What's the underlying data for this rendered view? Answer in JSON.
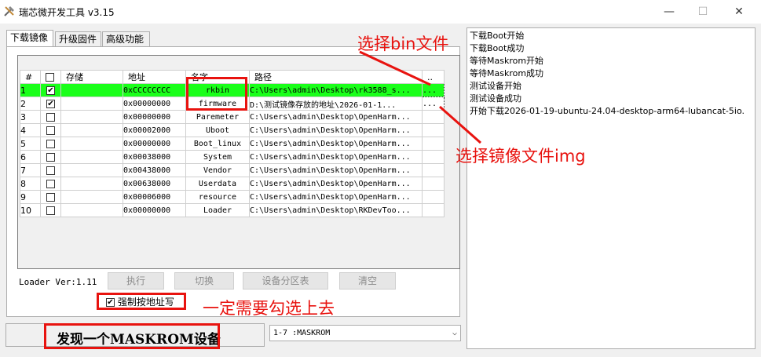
{
  "window": {
    "title": "瑞芯微开发工具 v3.15",
    "controls": [
      "—",
      "☐",
      "✕"
    ]
  },
  "tabs": [
    "下载镜像",
    "升级固件",
    "高级功能"
  ],
  "grid": {
    "headers": [
      "#",
      "☐",
      "存储",
      "地址",
      "名字",
      "路径",
      ".."
    ],
    "rows": [
      {
        "num": "1",
        "checked": true,
        "storage": "",
        "addr": "0xCCCCCCCC",
        "name": "rkbin",
        "path": "C:\\Users\\admin\\Desktop\\rk3588_s...",
        "extra": "..."
      },
      {
        "num": "2",
        "checked": true,
        "storage": "",
        "addr": "0x00000000",
        "name": "firmware",
        "path": "D:\\测试镜像存放的地址\\2026-01-1...",
        "extra": "..."
      },
      {
        "num": "3",
        "checked": false,
        "storage": "",
        "addr": "0x00000000",
        "name": "Paremeter",
        "path": "C:\\Users\\admin\\Desktop\\OpenHarm...",
        "extra": ""
      },
      {
        "num": "4",
        "checked": false,
        "storage": "",
        "addr": "0x00002000",
        "name": "Uboot",
        "path": "C:\\Users\\admin\\Desktop\\OpenHarm...",
        "extra": ""
      },
      {
        "num": "5",
        "checked": false,
        "storage": "",
        "addr": "0x00000000",
        "name": "Boot_linux",
        "path": "C:\\Users\\admin\\Desktop\\OpenHarm...",
        "extra": ""
      },
      {
        "num": "6",
        "checked": false,
        "storage": "",
        "addr": "0x00038000",
        "name": "System",
        "path": "C:\\Users\\admin\\Desktop\\OpenHarm...",
        "extra": ""
      },
      {
        "num": "7",
        "checked": false,
        "storage": "",
        "addr": "0x00438000",
        "name": "Vendor",
        "path": "C:\\Users\\admin\\Desktop\\OpenHarm...",
        "extra": ""
      },
      {
        "num": "8",
        "checked": false,
        "storage": "",
        "addr": "0x00638000",
        "name": "Userdata",
        "path": "C:\\Users\\admin\\Desktop\\OpenHarm...",
        "extra": ""
      },
      {
        "num": "9",
        "checked": false,
        "storage": "",
        "addr": "0x00006000",
        "name": "resource",
        "path": "C:\\Users\\admin\\Desktop\\OpenHarm...",
        "extra": ""
      },
      {
        "num": "10",
        "checked": false,
        "storage": "",
        "addr": "0x00000000",
        "name": "Loader",
        "path": "C:\\Users\\admin\\Desktop\\RKDevToo...",
        "extra": ""
      }
    ]
  },
  "loader_ver": "Loader Ver:1.11",
  "buttons": {
    "execute": "执行",
    "switch": "切换",
    "partition": "设备分区表",
    "clear": "清空"
  },
  "force_write": {
    "checked": true,
    "label": "强制按地址写"
  },
  "status": "发现一个MASKROM设备",
  "device_combo": "1-7 :MASKROM",
  "log": [
    "下载Boot开始",
    "下载Boot成功",
    "等待Maskrom开始",
    "等待Maskrom成功",
    "测试设备开始",
    "测试设备成功",
    "开始下载2026-01-19-ubuntu-24.04-desktop-arm64-lubancat-5io."
  ],
  "annotations": {
    "select_bin": "选择bin文件",
    "select_img": "选择镜像文件img",
    "must_check": "一定需要勾选上去"
  },
  "colors": {
    "highlight_row": "#1aff1a",
    "annotation_red": "#e8130f"
  }
}
